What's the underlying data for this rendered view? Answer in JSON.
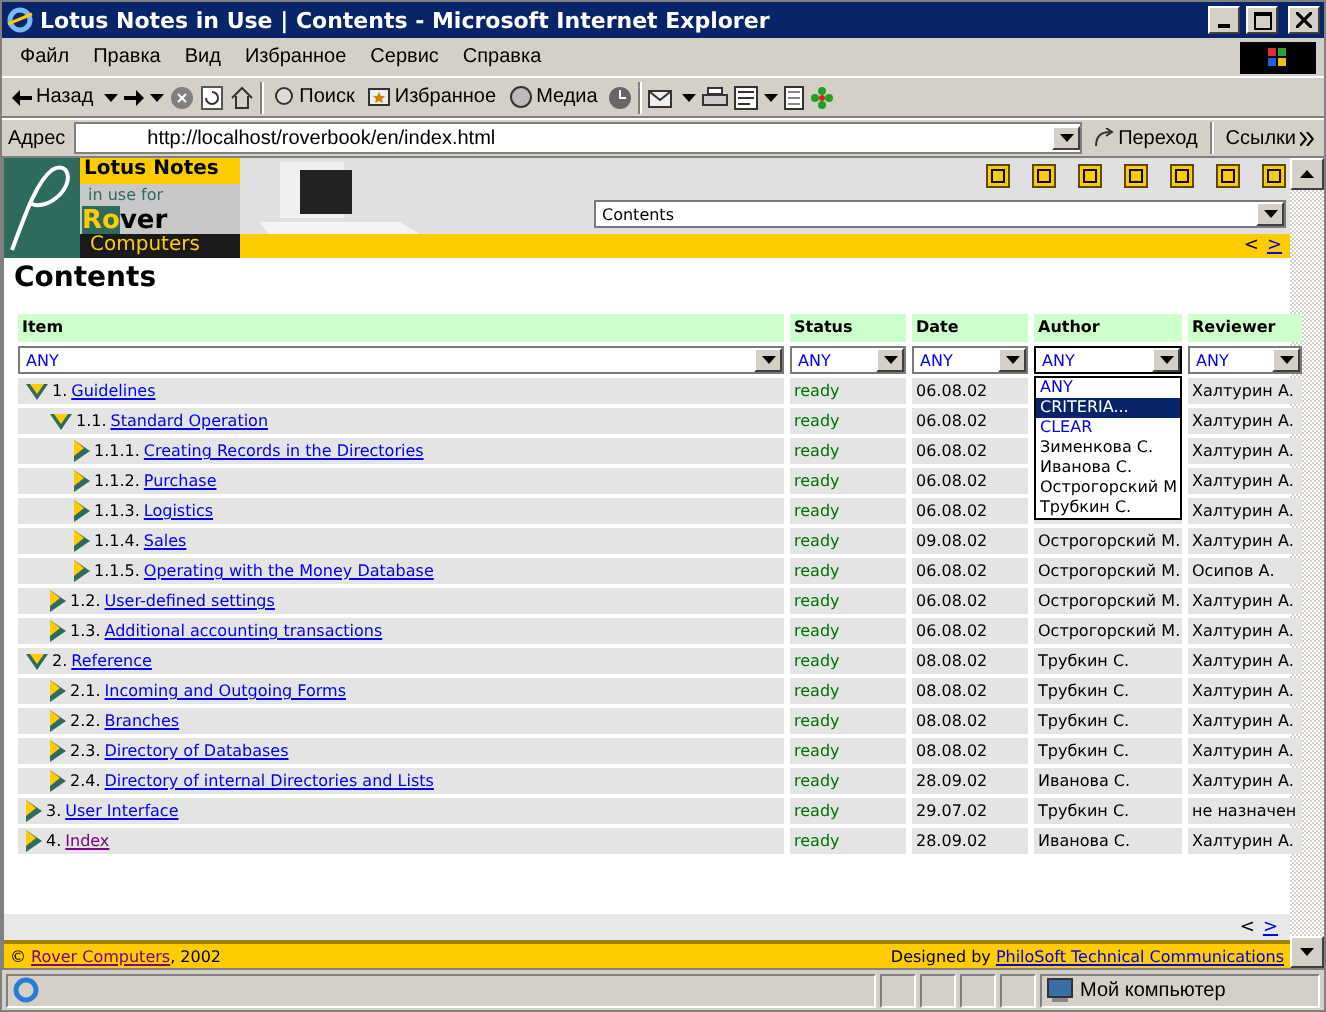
{
  "window": {
    "title": "Lotus Notes in Use | Contents - Microsoft Internet Explorer"
  },
  "menu": [
    "Файл",
    "Правка",
    "Вид",
    "Избранное",
    "Сервис",
    "Справка"
  ],
  "toolbar": {
    "back": "Назад",
    "search": "Поиск",
    "favorites": "Избранное",
    "media": "Медиа"
  },
  "address": {
    "label": "Адрес",
    "value": "http://localhost/roverbook/en/index.html",
    "go": "Переход",
    "links": "Ссылки"
  },
  "banner": {
    "brand_top": "Lotus  Notes",
    "brand_mid": "in use for",
    "brand_ro": "Ro",
    "brand_ver": "ver",
    "brand_bottom": "Computers",
    "section_select": "Contents",
    "prev": "<",
    "next": ">"
  },
  "heading": "Contents",
  "table": {
    "columns": [
      "Item",
      "Status",
      "Date",
      "Author",
      "Reviewer"
    ],
    "filters": [
      {
        "value": "ANY",
        "open": false
      },
      {
        "value": "ANY",
        "open": false
      },
      {
        "value": "ANY",
        "open": false
      },
      {
        "value": "ANY",
        "open": true
      },
      {
        "value": "ANY",
        "open": false
      }
    ],
    "author_options": [
      {
        "kind": "keyword",
        "label": "ANY",
        "selected": false
      },
      {
        "kind": "keyword",
        "label": "CRITERIA...",
        "selected": true
      },
      {
        "kind": "keyword",
        "label": "CLEAR",
        "selected": false
      },
      {
        "kind": "name",
        "label": "Зименкова С.",
        "selected": false
      },
      {
        "kind": "name",
        "label": "Иванова С.",
        "selected": false
      },
      {
        "kind": "name",
        "label": "Острогорский М",
        "selected": false
      },
      {
        "kind": "name",
        "label": "Трубкин С.",
        "selected": false
      }
    ],
    "rows": [
      {
        "number": "1.",
        "title": "Guidelines",
        "visited": false,
        "expanded": true,
        "status": "ready",
        "date": "06.08.02",
        "reviewer": "Халтурин А.",
        "children": [
          {
            "number": "1.1.",
            "title": "Standard Operation",
            "visited": false,
            "expanded": true,
            "status": "ready",
            "date": "06.08.02",
            "reviewer": "Халтурин А.",
            "children": [
              {
                "number": "1.1.1.",
                "title": "Creating Records in the Directories",
                "visited": false,
                "expanded": false,
                "status": "ready",
                "date": "06.08.02",
                "reviewer": "Халтурин А."
              },
              {
                "number": "1.1.2.",
                "title": "Purchase",
                "visited": false,
                "expanded": false,
                "status": "ready",
                "date": "06.08.02",
                "reviewer": "Халтурин А."
              },
              {
                "number": "1.1.3.",
                "title": "Logistics",
                "visited": false,
                "expanded": false,
                "status": "ready",
                "date": "06.08.02",
                "reviewer": "Халтурин А."
              },
              {
                "number": "1.1.4.",
                "title": "Sales",
                "visited": false,
                "expanded": false,
                "status": "ready",
                "date": "09.08.02",
                "author": "Острогорский М.",
                "reviewer": "Халтурин А."
              },
              {
                "number": "1.1.5.",
                "title": "Operating with the Money Database",
                "visited": false,
                "expanded": false,
                "status": "ready",
                "date": "06.08.02",
                "author": "Острогорский М.",
                "reviewer": "Осипов А."
              }
            ]
          },
          {
            "number": "1.2.",
            "title": "User-defined settings",
            "visited": false,
            "expanded": false,
            "status": "ready",
            "date": "06.08.02",
            "author": "Острогорский М.",
            "reviewer": "Халтурин А."
          },
          {
            "number": "1.3.",
            "title": "Additional accounting transactions",
            "visited": false,
            "expanded": false,
            "status": "ready",
            "date": "06.08.02",
            "author": "Острогорский М.",
            "reviewer": "Халтурин А."
          }
        ]
      },
      {
        "number": "2.",
        "title": "Reference",
        "visited": false,
        "expanded": true,
        "status": "ready",
        "date": "08.08.02",
        "author": "Трубкин С.",
        "reviewer": "Халтурин А.",
        "children": [
          {
            "number": "2.1.",
            "title": "Incoming and Outgoing Forms",
            "visited": false,
            "expanded": false,
            "status": "ready",
            "date": "08.08.02",
            "author": "Трубкин С.",
            "reviewer": "Халтурин А."
          },
          {
            "number": "2.2.",
            "title": "Branches",
            "visited": false,
            "expanded": false,
            "status": "ready",
            "date": "08.08.02",
            "author": "Трубкин С.",
            "reviewer": "Халтурин А."
          },
          {
            "number": "2.3.",
            "title": "Directory of Databases",
            "visited": false,
            "expanded": false,
            "status": "ready",
            "date": "08.08.02",
            "author": "Трубкин С.",
            "reviewer": "Халтурин А."
          },
          {
            "number": "2.4.",
            "title": "Directory of internal Directories and Lists",
            "visited": false,
            "expanded": false,
            "status": "ready",
            "date": "28.09.02",
            "author": "Иванова С.",
            "reviewer": "Халтурин А."
          }
        ]
      },
      {
        "number": "3.",
        "title": "User Interface",
        "visited": false,
        "expanded": false,
        "status": "ready",
        "date": "29.07.02",
        "author": "Трубкин С.",
        "reviewer": "не назначен"
      },
      {
        "number": "4.",
        "title": "Index",
        "visited": true,
        "expanded": false,
        "status": "ready",
        "date": "28.09.02",
        "author": "Иванова С.",
        "reviewer": "Халтурин А."
      }
    ]
  },
  "bottom_nav": {
    "prev": "<",
    "next": ">"
  },
  "footer": {
    "copyright": "©",
    "company": "Rover Computers",
    "year": ", 2002",
    "designed_by": "Designed by",
    "designer": "PhiloSoft Technical Communications"
  },
  "status_bar": {
    "zone": "Мой компьютер"
  }
}
